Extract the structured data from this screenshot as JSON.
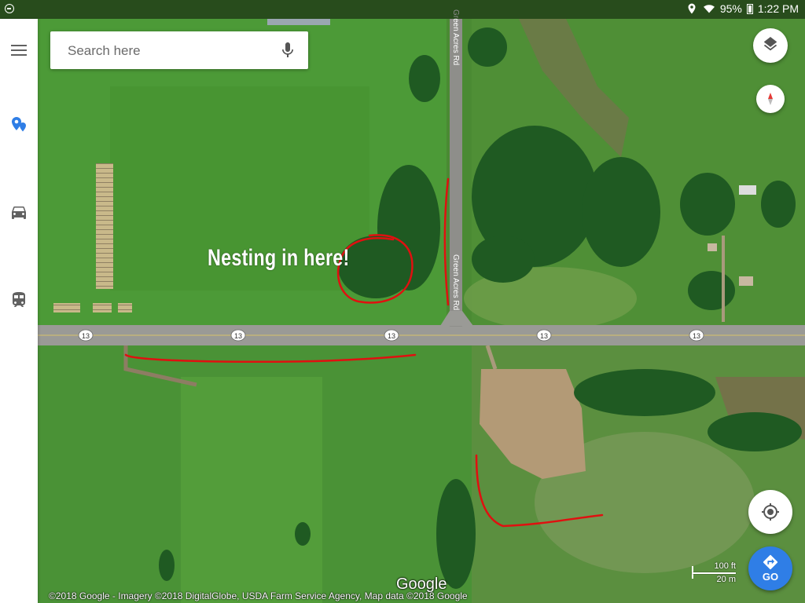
{
  "status_bar": {
    "battery": "95%",
    "time": "1:22 PM",
    "icons": [
      "location-icon",
      "wifi-icon",
      "battery-icon"
    ]
  },
  "search": {
    "placeholder": "Search here"
  },
  "sidebar": {
    "items": [
      {
        "icon": "menu-icon"
      },
      {
        "icon": "explore-pin-icon",
        "color": "#2f7ee6"
      },
      {
        "icon": "car-icon"
      },
      {
        "icon": "transit-icon"
      }
    ]
  },
  "map": {
    "road_labels": {
      "vertical_road": "Green Acres Rd",
      "highway_shield": "13"
    },
    "annotation": "Nesting in here!",
    "annotation_color": "#e01010",
    "scale": {
      "top": "100 ft",
      "bottom": "20 m"
    },
    "google_logo": "Google",
    "attribution": "©2018 Google - Imagery ©2018 DigitalGlobe, USDA Farm Service Agency, Map data ©2018 Google"
  },
  "controls": {
    "layers_icon": "layers-icon",
    "compass_icon": "compass-icon",
    "my_location_icon": "my-location-icon",
    "go_label": "GO",
    "go_color": "#2f7ee6"
  }
}
